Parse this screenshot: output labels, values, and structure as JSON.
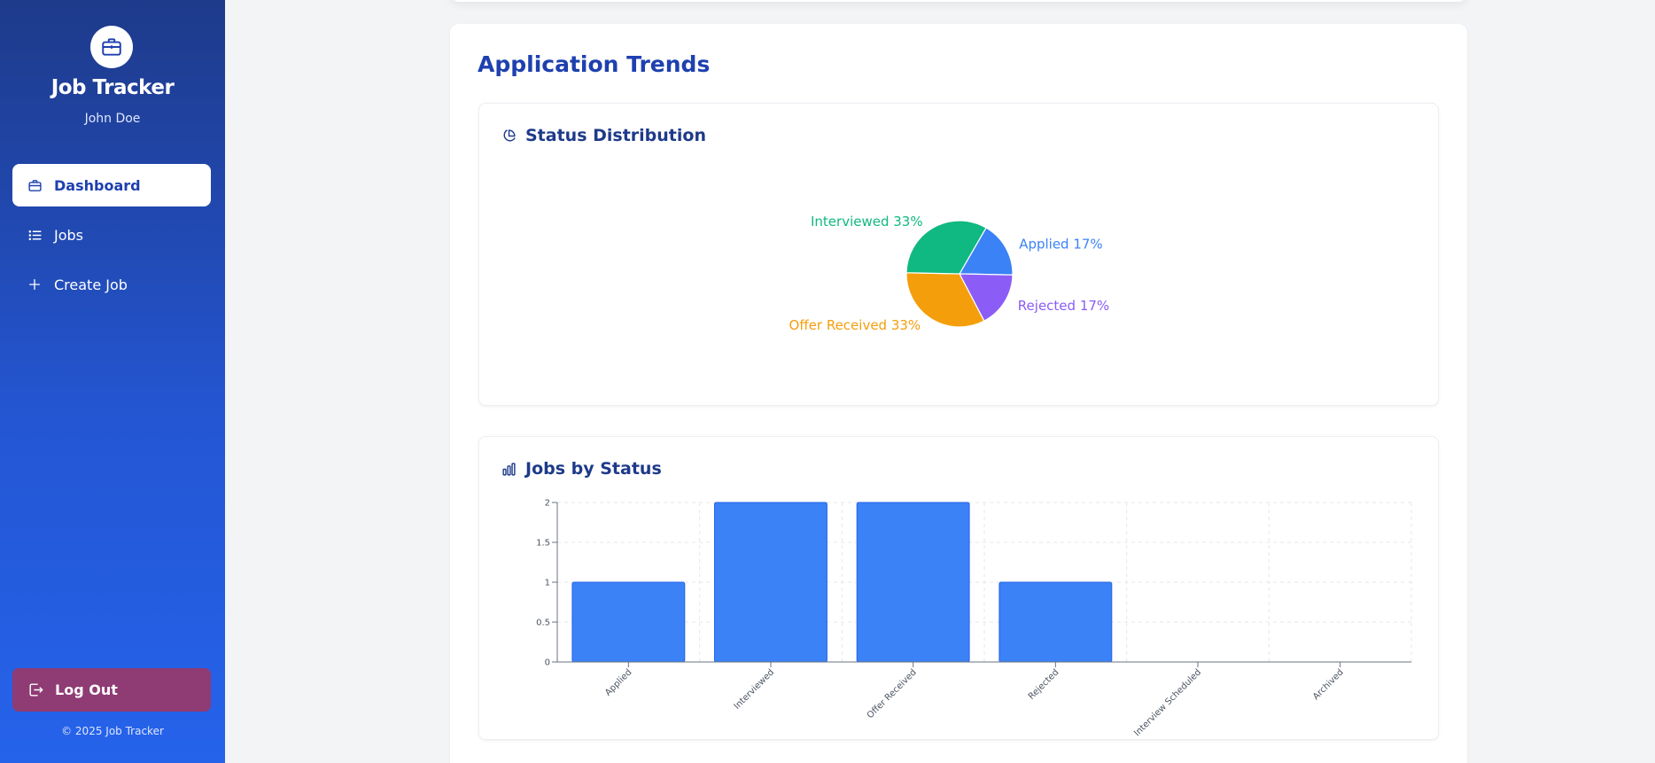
{
  "sidebar": {
    "brand": "Job Tracker",
    "user": "John Doe",
    "nav": [
      {
        "label": "Dashboard",
        "icon": "briefcase-icon",
        "active": true
      },
      {
        "label": "Jobs",
        "icon": "list-icon",
        "active": false
      },
      {
        "label": "Create Job",
        "icon": "plus-icon",
        "active": false
      }
    ],
    "logout_label": "Log Out",
    "copyright": "© 2025 Job Tracker"
  },
  "main": {
    "section_title": "Application Trends",
    "pie_card_title": "Status Distribution",
    "bar_card_title": "Jobs by Status"
  },
  "colors": {
    "primary": "#1e40af",
    "applied": "#3b82f6",
    "interviewed": "#10b981",
    "offer": "#f59e0b",
    "rejected": "#8b5cf6",
    "bar": "#3b82f6",
    "logout": "#8f3b74"
  },
  "chart_data": [
    {
      "type": "pie",
      "title": "Status Distribution",
      "slices": [
        {
          "label": "Applied",
          "value": 17,
          "text": "Applied 17%",
          "color": "#3b82f6"
        },
        {
          "label": "Rejected",
          "value": 17,
          "text": "Rejected 17%",
          "color": "#8b5cf6"
        },
        {
          "label": "Offer Received",
          "value": 33,
          "text": "Offer Received 33%",
          "color": "#f59e0b"
        },
        {
          "label": "Interviewed",
          "value": 33,
          "text": "Interviewed 33%",
          "color": "#10b981"
        }
      ]
    },
    {
      "type": "bar",
      "title": "Jobs by Status",
      "categories": [
        "Applied",
        "Interviewed",
        "Offer Received",
        "Rejected",
        "Interview Scheduled",
        "Archived"
      ],
      "values": [
        1,
        2,
        2,
        1,
        0,
        0
      ],
      "ylim": [
        0,
        2
      ],
      "yticks": [
        "0",
        "0.5",
        "1",
        "1.5",
        "2"
      ],
      "grid": true,
      "color": "#3b82f6"
    }
  ]
}
